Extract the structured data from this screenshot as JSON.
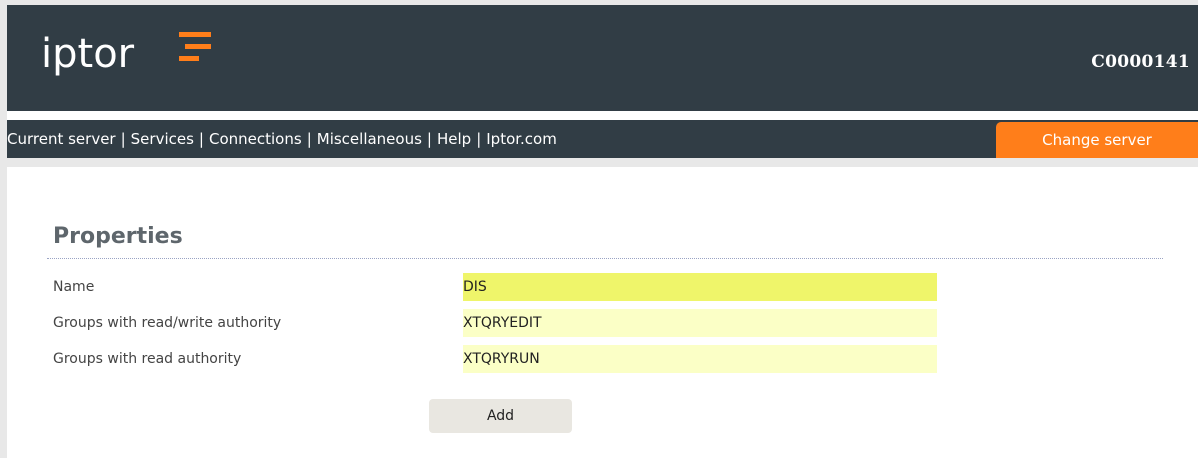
{
  "header": {
    "logo_text": "iptor",
    "server_id": "C0000141",
    "brand_color": "#313d45",
    "accent_color": "#ff7e1a"
  },
  "nav": {
    "links": [
      "Current server",
      "Services",
      "Connections",
      "Miscellaneous",
      "Help",
      "Iptor.com"
    ],
    "separator": "|",
    "change_server_label": "Change server"
  },
  "properties": {
    "title": "Properties",
    "fields": [
      {
        "label": "Name",
        "value": "DIS"
      },
      {
        "label": "Groups with read/write authority",
        "value": "XTQRYEDIT"
      },
      {
        "label": "Groups with read authority",
        "value": "XTQRYRUN"
      }
    ],
    "add_label": "Add"
  }
}
